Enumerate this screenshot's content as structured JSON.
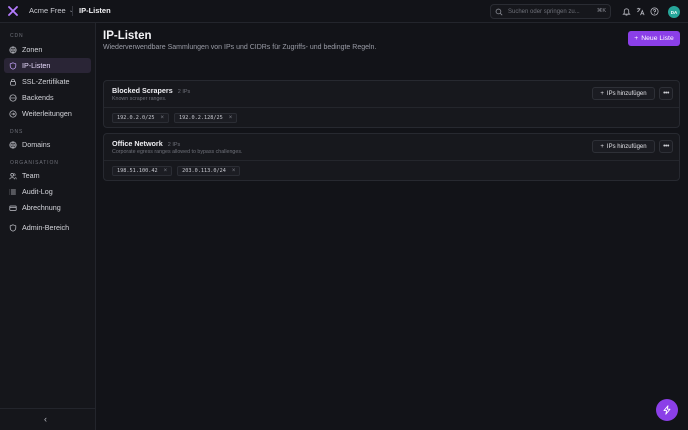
{
  "header": {
    "org_name": "Acme Free",
    "breadcrumb": "IP-Listen",
    "search_placeholder": "Suchen oder springen zu...",
    "search_shortcut": "⌘K",
    "avatar_initials": "DA"
  },
  "sidebar": {
    "sections": [
      {
        "title": "CDN",
        "items": [
          {
            "label": "Zonen",
            "icon": "globe-icon"
          },
          {
            "label": "IP-Listen",
            "icon": "shield-icon",
            "active": true
          },
          {
            "label": "SSL-Zertifikate",
            "icon": "lock-icon"
          },
          {
            "label": "Backends",
            "icon": "server-icon"
          },
          {
            "label": "Weiterleitungen",
            "icon": "redirect-icon"
          }
        ]
      },
      {
        "title": "DNS",
        "items": [
          {
            "label": "Domains",
            "icon": "globe-icon"
          }
        ]
      },
      {
        "title": "ORGANISATION",
        "items": [
          {
            "label": "Team",
            "icon": "users-icon"
          },
          {
            "label": "Audit-Log",
            "icon": "list-icon"
          },
          {
            "label": "Abrechnung",
            "icon": "card-icon"
          },
          {
            "label": "Admin-Bereich",
            "icon": "shield-icon"
          }
        ]
      }
    ]
  },
  "page": {
    "title": "IP-Listen",
    "subtitle": "Wiederverwendbare Sammlungen von IPs und CIDRs für Zugriffs- und bedingte Regeln.",
    "new_button": "Neue Liste"
  },
  "lists": [
    {
      "name": "Blocked Scrapers",
      "count": "2 IPs",
      "description": "Known scraper ranges.",
      "add_label": "IPs hinzufügen",
      "entries": [
        "192.0.2.0/25",
        "192.0.2.128/25"
      ]
    },
    {
      "name": "Office Network",
      "count": "2 IPs",
      "description": "Corporate egress ranges allowed to bypass challenges.",
      "add_label": "IPs hinzufügen",
      "entries": [
        "198.51.100.42",
        "203.0.113.0/24"
      ]
    }
  ],
  "colors": {
    "accent": "#8b3fe8",
    "avatar": "#27a69a",
    "background": "#121318"
  }
}
